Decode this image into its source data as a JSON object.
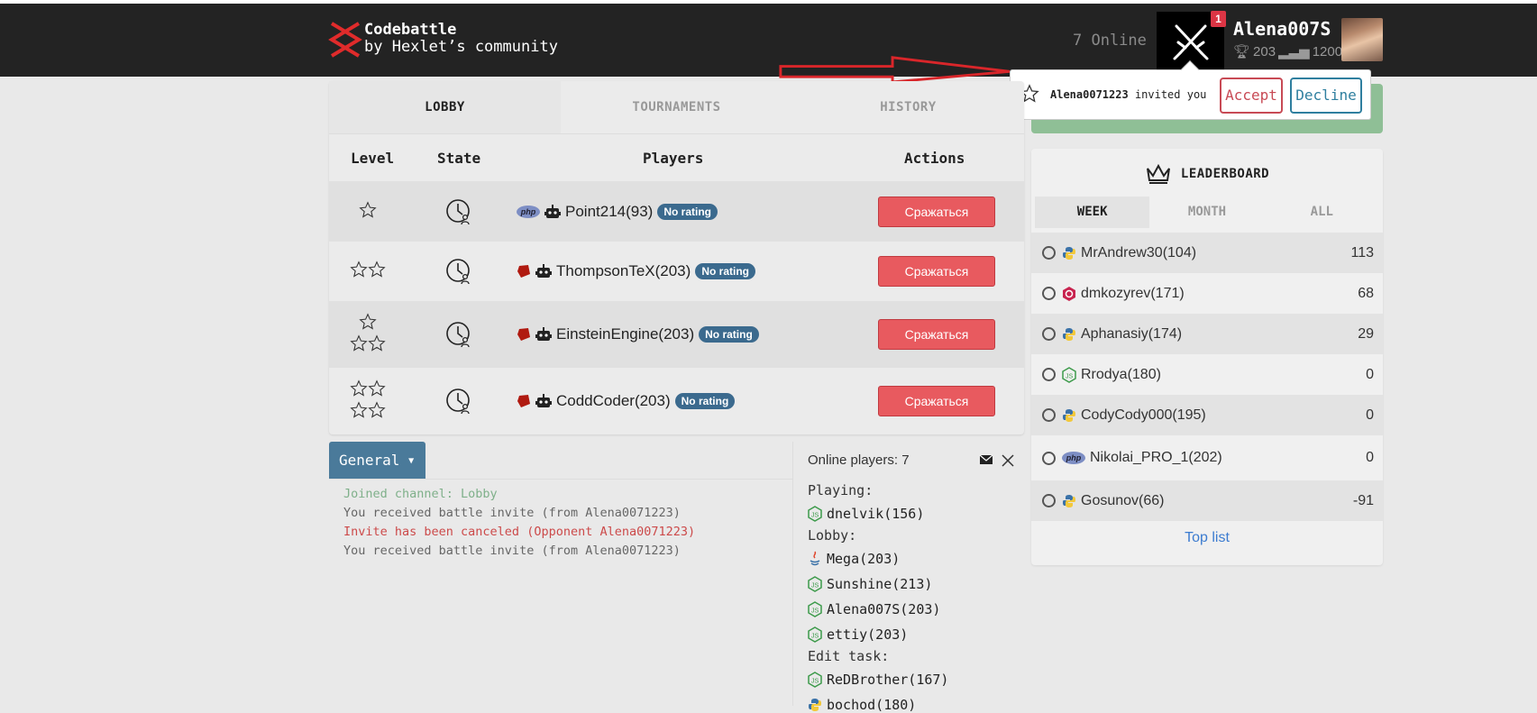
{
  "brand": {
    "name": "Codebattle",
    "sub": "by Hexlet’s community"
  },
  "header": {
    "online": "7 Online",
    "notif_count": "1",
    "username": "Alena007S",
    "rating": "203",
    "points": "1200"
  },
  "invite": {
    "from": "Alena0071223",
    "text": "invited you",
    "accept": "Accept",
    "decline": "Decline"
  },
  "tabs": [
    "LOBBY",
    "TOURNAMENTS",
    "HISTORY"
  ],
  "columns": {
    "level": "Level",
    "state": "State",
    "players": "Players",
    "actions": "Actions"
  },
  "games": [
    {
      "stars": 1,
      "lang": "php-icon",
      "player": "Point214(93)",
      "badge": "No rating",
      "action": "Сражаться"
    },
    {
      "stars": 2,
      "lang": "ruby-icon",
      "player": "ThompsonTeX(203)",
      "badge": "No rating",
      "action": "Сражаться"
    },
    {
      "stars": 3,
      "lang": "ruby-icon",
      "player": "EinsteinEngine(203)",
      "badge": "No rating",
      "action": "Сражаться"
    },
    {
      "stars": 4,
      "lang": "ruby-icon",
      "player": "CoddCoder(203)",
      "badge": "No rating",
      "action": "Сражаться"
    }
  ],
  "chat": {
    "channel": "General",
    "messages": [
      {
        "text": "Joined channel: Lobby",
        "type": "system"
      },
      {
        "text": "You received battle invite (from Alena0071223)",
        "type": "info"
      },
      {
        "text": "Invite has been canceled (Opponent Alena0071223)",
        "type": "error"
      },
      {
        "text": "You received battle invite (from Alena0071223)",
        "type": "info"
      }
    ]
  },
  "online_players": {
    "title": "Online players: 7",
    "playing_label": "Playing:",
    "playing": [
      {
        "name": "dnelvik(156)",
        "lang": "js-icon"
      }
    ],
    "lobby_label": "Lobby:",
    "lobby": [
      {
        "name": "Mega(203)",
        "lang": "java-icon"
      },
      {
        "name": "Sunshine(213)",
        "lang": "js-icon"
      },
      {
        "name": "Alena007S(203)",
        "lang": "js-icon"
      },
      {
        "name": "ettiy(203)",
        "lang": "js-icon"
      }
    ],
    "edit_label": "Edit task:",
    "edit": [
      {
        "name": "ReDBrother(167)",
        "lang": "js-icon"
      },
      {
        "name": "bochod(180)",
        "lang": "python-icon"
      }
    ]
  },
  "leaderboard": {
    "title": "LEADERBOARD",
    "tabs": [
      "WEEK",
      "MONTH",
      "ALL"
    ],
    "rows": [
      {
        "name": "MrAndrew30(104)",
        "lang": "python-icon",
        "score": "113"
      },
      {
        "name": "dmkozyrev(171)",
        "lang": "cpp-icon",
        "score": "68"
      },
      {
        "name": "Aphanasiy(174)",
        "lang": "python-icon",
        "score": "29"
      },
      {
        "name": "Rrodya(180)",
        "lang": "js-icon",
        "score": "0"
      },
      {
        "name": "CodyCody000(195)",
        "lang": "python-icon",
        "score": "0"
      },
      {
        "name": "Nikolai_PRO_1(202)",
        "lang": "php-icon",
        "score": "0"
      },
      {
        "name": "Gosunov(66)",
        "lang": "python-icon",
        "score": "-91"
      }
    ],
    "link": "Top list"
  },
  "colors": {
    "header": "#232323",
    "fight": "#e85a5f",
    "accept": "#c84a55",
    "decline": "#2f7f9f",
    "badge": "#3b6a8e",
    "annotation_arrow": "#d9262a"
  }
}
